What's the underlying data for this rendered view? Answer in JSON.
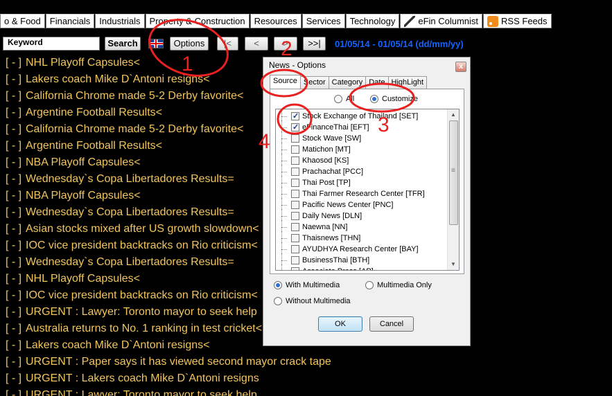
{
  "category_tabs": [
    {
      "label": "o & Food"
    },
    {
      "label": "Financials"
    },
    {
      "label": "Industrials"
    },
    {
      "label": "Property & Construction"
    },
    {
      "label": "Resources"
    },
    {
      "label": "Services"
    },
    {
      "label": "Technology"
    },
    {
      "label": "eFin Columnist",
      "icon": "pen-icon"
    },
    {
      "label": "RSS Feeds",
      "icon": "rss-icon"
    }
  ],
  "toolbar": {
    "keyword_value": "Keyword",
    "search_label": "Search",
    "options_label": "Options",
    "first_label": "|<",
    "prev_label": "<",
    "next_label": ">",
    "last_label": ">>|",
    "date_range": "01/05/14 - 01/05/14 (dd/mm/yy)",
    "flag_icon": "uk-flag-icon"
  },
  "headlines": [
    {
      "bullet": "[ - ]",
      "text": "NHL Playoff Capsules<"
    },
    {
      "bullet": "[ - ]",
      "text": "Lakers coach Mike D`Antoni resigns<"
    },
    {
      "bullet": "[ - ]",
      "text": "California Chrome made 5-2 Derby favorite<"
    },
    {
      "bullet": "[ - ]",
      "text": "Argentine Football Results<"
    },
    {
      "bullet": "[ - ]",
      "text": "California Chrome made 5-2 Derby favorite<"
    },
    {
      "bullet": "[ - ]",
      "text": "Argentine Football Results<"
    },
    {
      "bullet": "[ - ]",
      "text": "NBA Playoff Capsules<"
    },
    {
      "bullet": "[ - ]",
      "text": "Wednesday`s Copa Libertadores Results="
    },
    {
      "bullet": "[ - ]",
      "text": "NBA Playoff Capsules<"
    },
    {
      "bullet": "[ - ]",
      "text": "Wednesday`s Copa Libertadores Results="
    },
    {
      "bullet": "[ - ]",
      "text": "Asian stocks mixed after US growth slowdown<"
    },
    {
      "bullet": "[ - ]",
      "text": "IOC vice president backtracks on Rio criticism<"
    },
    {
      "bullet": "[ - ]",
      "text": "Wednesday`s Copa Libertadores Results="
    },
    {
      "bullet": "[ - ]",
      "text": "NHL Playoff Capsules<"
    },
    {
      "bullet": "[ - ]",
      "text": "IOC vice president backtracks on Rio criticism<"
    },
    {
      "bullet": "[ - ]",
      "text": "URGENT : Lawyer: Toronto mayor to seek help"
    },
    {
      "bullet": "[ - ]",
      "text": "Australia returns to No. 1 ranking in test cricket<"
    },
    {
      "bullet": "[ - ]",
      "text": "Lakers coach Mike D`Antoni resigns<"
    },
    {
      "bullet": "[ - ]",
      "text": "URGENT : Paper says it has viewed second mayor crack tape"
    },
    {
      "bullet": "[ - ]",
      "text": "URGENT : Lakers coach Mike D`Antoni resigns"
    },
    {
      "bullet": "[ - ]",
      "text": "URGENT : Lawyer: Toronto mayor to seek help"
    }
  ],
  "dialog": {
    "title": "News - Options",
    "close_glyph": "x",
    "tabs": [
      {
        "label": "Source",
        "active": true
      },
      {
        "label": "Sector"
      },
      {
        "label": "Category"
      },
      {
        "label": "Date"
      },
      {
        "label": "HighLight"
      }
    ],
    "source_mode": {
      "all_label": "All",
      "customize_label": "Customize",
      "selected": "Customize"
    },
    "sources": [
      {
        "label": "Stock Exchange of Thailand [SET]",
        "checked": true
      },
      {
        "label": "eFinanceThai [EFT]",
        "checked": true
      },
      {
        "label": "Stock Wave [SW]",
        "checked": false
      },
      {
        "label": "Matichon [MT]",
        "checked": false
      },
      {
        "label": "Khaosod [KS]",
        "checked": false
      },
      {
        "label": "Prachachat [PCC]",
        "checked": false
      },
      {
        "label": "Thai Post [TP]",
        "checked": false
      },
      {
        "label": "Thai Farmer Research Center [TFR]",
        "checked": false
      },
      {
        "label": "Pacific News Center [PNC]",
        "checked": false
      },
      {
        "label": "Daily News [DLN]",
        "checked": false
      },
      {
        "label": "Naewna [NN]",
        "checked": false
      },
      {
        "label": "Thaisnews [THN]",
        "checked": false
      },
      {
        "label": "AYUDHYA Research Center [BAY]",
        "checked": false
      },
      {
        "label": "BusinessThai [BTH]",
        "checked": false
      },
      {
        "label": "Associate Press [AP]",
        "checked": false
      }
    ],
    "multimedia": {
      "with_label": "With Multimedia",
      "only_label": "Multimedia Only",
      "without_label": "Without Multimedia",
      "selected": "With Multimedia"
    },
    "ok_label": "OK",
    "cancel_label": "Cancel"
  },
  "annotations": {
    "color": "#e82020",
    "numbers": [
      "1",
      "2",
      "3",
      "4"
    ]
  },
  "colors": {
    "headline_text": "#f3c55c",
    "date_text": "#1463ff",
    "background": "#000000"
  }
}
